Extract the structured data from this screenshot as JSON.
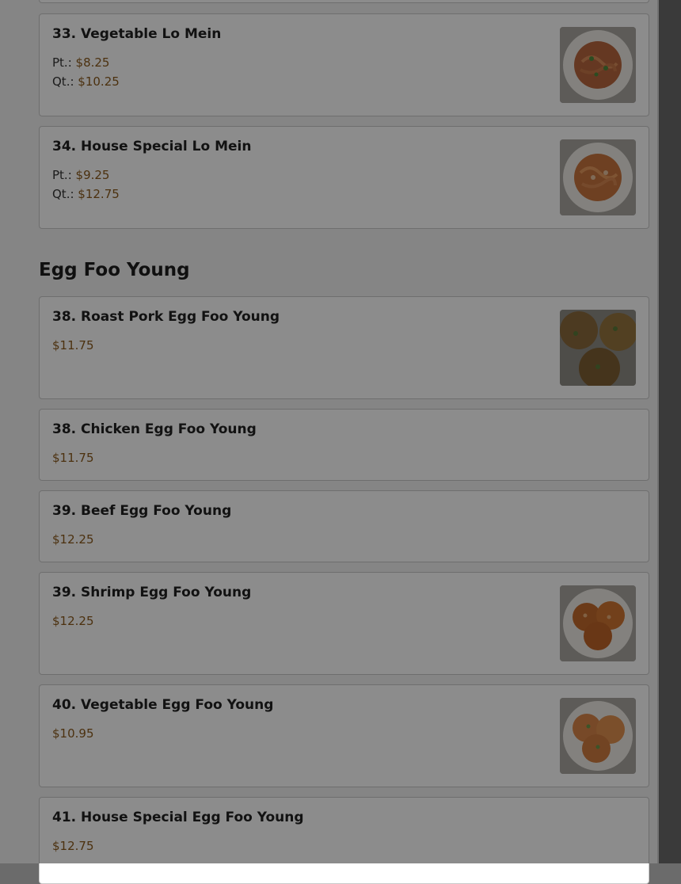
{
  "menu": {
    "lo_mein_items": [
      {
        "name": "33. Vegetable Lo Mein",
        "pt_label": "Pt.:",
        "pt_price": "$8.25",
        "qt_label": "Qt.:",
        "qt_price": "$10.25",
        "image": "vegetable-lo-mein-photo"
      },
      {
        "name": "34. House Special Lo Mein",
        "pt_label": "Pt.:",
        "pt_price": "$9.25",
        "qt_label": "Qt.:",
        "qt_price": "$12.75",
        "image": "house-special-lo-mein-photo"
      }
    ],
    "egg_foo_young": {
      "heading": "Egg Foo Young",
      "items": [
        {
          "name": "38. Roast Pork Egg Foo Young",
          "price": "$11.75",
          "image": "roast-pork-egg-foo-young-photo"
        },
        {
          "name": "38. Chicken Egg Foo Young",
          "price": "$11.75"
        },
        {
          "name": "39. Beef Egg Foo Young",
          "price": "$12.25"
        },
        {
          "name": "39. Shrimp Egg Foo Young",
          "price": "$12.25",
          "image": "shrimp-egg-foo-young-photo"
        },
        {
          "name": "40. Vegetable Egg Foo Young",
          "price": "$10.95",
          "image": "vegetable-egg-foo-young-photo"
        },
        {
          "name": "41. House Special Egg Foo Young",
          "price": "$12.75"
        }
      ]
    }
  },
  "colors": {
    "price_accent": "#8a5a1c",
    "overlay": "rgba(0,0,0,0.45)"
  }
}
